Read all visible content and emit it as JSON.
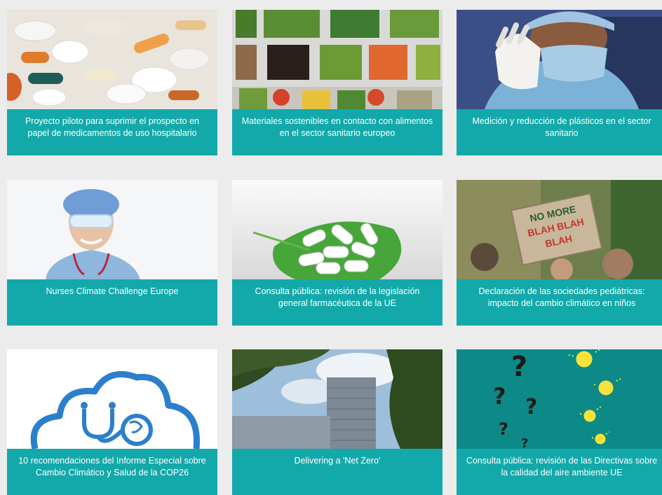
{
  "cards": [
    {
      "title": "Proyecto piloto para suprimir el prospecto en papel de medicamentos de uso hospitalario",
      "image": "pills-image"
    },
    {
      "title": "Materiales sostenibles en contacto con alimentos en el sector sanitario europeo",
      "image": "food-bowls-image"
    },
    {
      "title": "Medición y reducción de plásticos en el sector sanitario",
      "image": "surgeon-mask-image"
    },
    {
      "title": "Nurses Climate Challenge Europe",
      "image": "nurse-image"
    },
    {
      "title": "Consulta pública: revisión de la legislación general farmacéutica de la UE",
      "image": "pills-on-leaf-image"
    },
    {
      "title": "Declaración de las sociedades pediátricas: impacto del cambio climático en niños",
      "image": "protest-sign-image"
    },
    {
      "title": "10 recomendaciones del Informe Especial sobre Cambio Climático y Salud de la COP26",
      "image": "cloud-stethoscope-icon"
    },
    {
      "title": "Delivering a 'Net Zero'",
      "image": "office-building-image"
    },
    {
      "title": "Consulta pública: revisión de las Directivas sobre la calidad del aire ambiente UE",
      "image": "question-lightbulbs-image"
    }
  ],
  "protest_sign": {
    "line1": "NO MORE",
    "line2": "BLAH BLAH",
    "line3": "BLAH"
  },
  "colors": {
    "caption_bg": "#13a9aa",
    "page_bg": "#ececec",
    "teal_panel": "#0d8a87"
  }
}
